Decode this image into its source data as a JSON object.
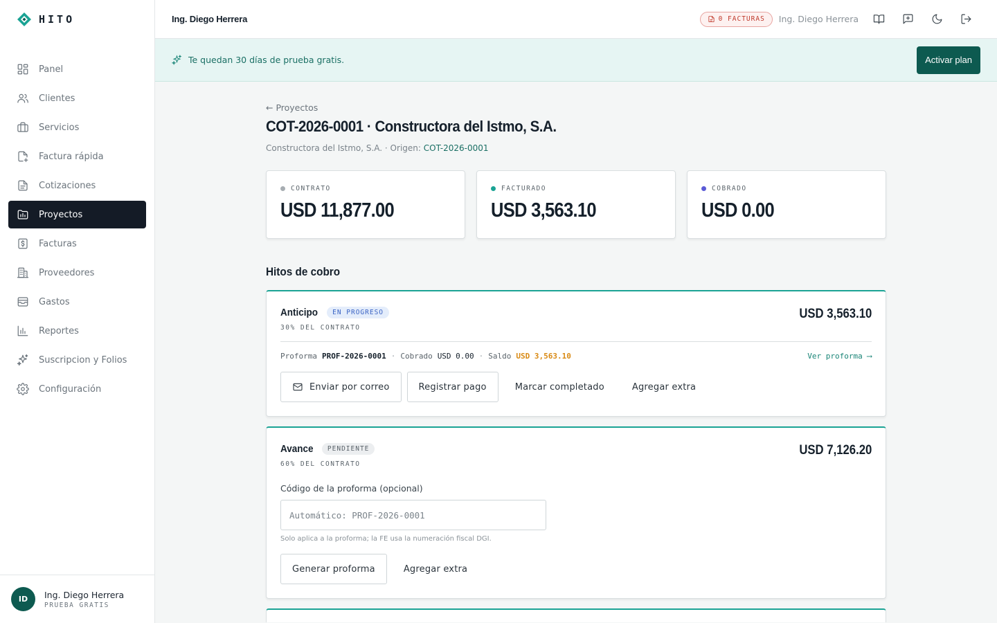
{
  "brand": {
    "name": "HITO"
  },
  "sidebar": {
    "items": [
      {
        "label": "Panel",
        "icon": "grid-icon"
      },
      {
        "label": "Clientes",
        "icon": "users-icon"
      },
      {
        "label": "Servicios",
        "icon": "briefcase-icon"
      },
      {
        "label": "Factura rápida",
        "icon": "file-plus-icon"
      },
      {
        "label": "Cotizaciones",
        "icon": "file-text-icon"
      },
      {
        "label": "Proyectos",
        "icon": "folder-chart-icon",
        "active": true
      },
      {
        "label": "Facturas",
        "icon": "dollar-file-icon"
      },
      {
        "label": "Proveedores",
        "icon": "building-icon"
      },
      {
        "label": "Gastos",
        "icon": "wallet-icon"
      },
      {
        "label": "Reportes",
        "icon": "bar-chart-icon"
      },
      {
        "label": "Suscripcion y Folios",
        "icon": "sparkles-icon"
      },
      {
        "label": "Configuración",
        "icon": "gear-icon"
      }
    ],
    "user": {
      "initials": "ID",
      "name": "Ing. Diego Herrera",
      "plan": "PRUEBA GRATIS"
    }
  },
  "topbar": {
    "title": "Ing. Diego Herrera",
    "facturas_badge": "0 FACTURAS",
    "user_name": "Ing. Diego Herrera"
  },
  "trial": {
    "text": "Te quedan 30 días de prueba gratis.",
    "button": "Activar plan"
  },
  "page": {
    "back": "← Proyectos",
    "title": "COT-2026-0001 · Constructora del Istmo, S.A.",
    "subtitle_prefix": "Constructora del Istmo, S.A. · Origen: ",
    "subtitle_link": "COT-2026-0001"
  },
  "stats": [
    {
      "label": "CONTRATO",
      "value": "USD 11,877.00",
      "color": "#a7adb2"
    },
    {
      "label": "FACTURADO",
      "value": "USD 3,563.10",
      "color": "#1aa394"
    },
    {
      "label": "COBRADO",
      "value": "USD 0.00",
      "color": "#5b5bd6"
    }
  ],
  "section_title": "Hitos de cobro",
  "hitos": [
    {
      "name": "Anticipo",
      "status": "EN PROGRESO",
      "pct": "30% DEL CONTRATO",
      "amount": "USD 3,563.10",
      "meta": {
        "proforma_label": "Proforma",
        "proforma": "PROF-2026-0001",
        "cobrado_label": "Cobrado",
        "cobrado": "USD 0.00",
        "saldo_label": "Saldo",
        "saldo": "USD 3,563.10",
        "link": "Ver proforma ⟶"
      },
      "actions": [
        "Enviar por correo",
        "Registrar pago",
        "Marcar completado",
        "Agregar extra"
      ]
    },
    {
      "name": "Avance",
      "status": "PENDIENTE",
      "pct": "60% DEL CONTRATO",
      "amount": "USD 7,126.20",
      "field_label": "Código de la proforma (opcional)",
      "field_placeholder": "Automático: PROF-2026-0001",
      "field_help": "Solo aplica a la proforma; la FE usa la numeración fiscal DGI.",
      "actions": [
        "Generar proforma",
        "Agregar extra"
      ]
    }
  ]
}
